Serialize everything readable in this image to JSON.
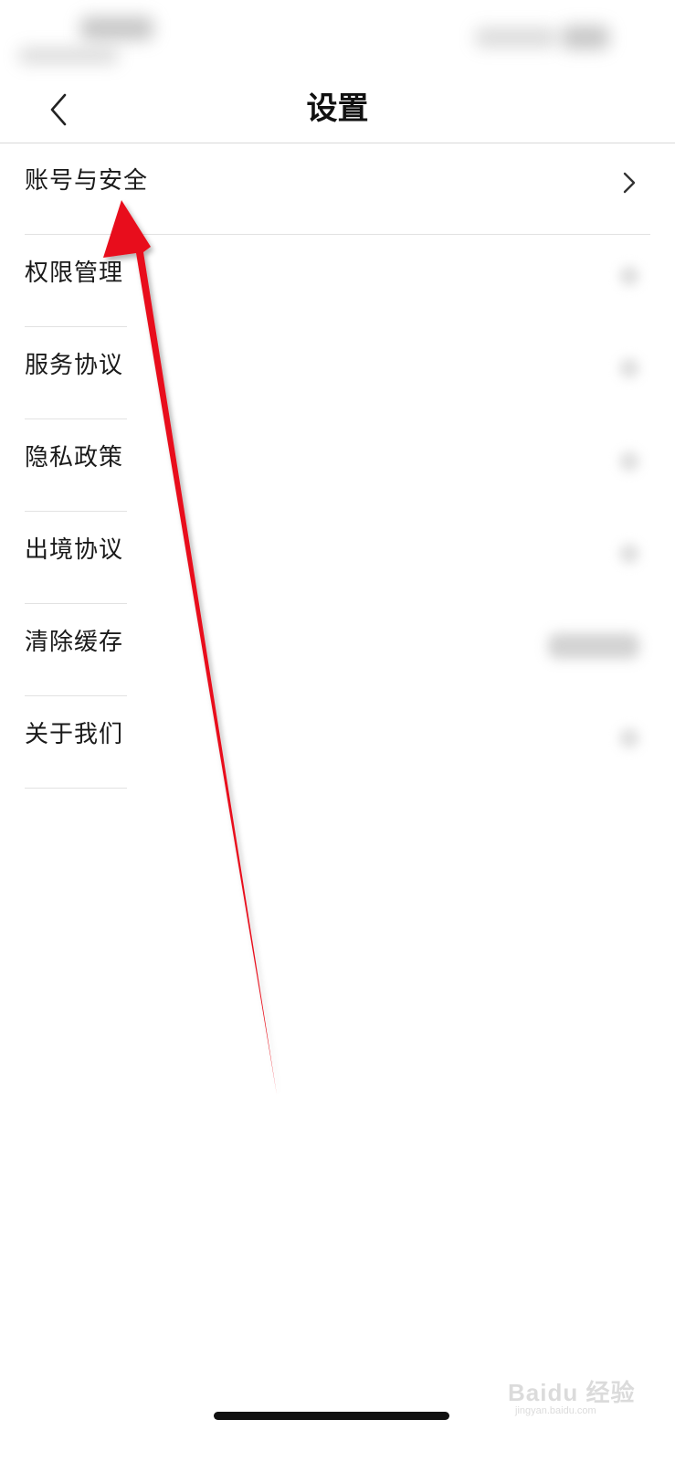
{
  "header": {
    "title": "设置",
    "back_icon": "chevron-left-icon"
  },
  "settings": {
    "items": [
      {
        "label": "账号与安全"
      },
      {
        "label": "权限管理"
      },
      {
        "label": "服务协议"
      },
      {
        "label": "隐私政策"
      },
      {
        "label": "出境协议"
      },
      {
        "label": "清除缓存"
      },
      {
        "label": "关于我们"
      }
    ]
  },
  "annotation": {
    "color": "#e8101a",
    "icon": "red-arrow-icon"
  },
  "watermark": {
    "brand": "Baidu 经验",
    "url": "jingyan.baidu.com"
  }
}
